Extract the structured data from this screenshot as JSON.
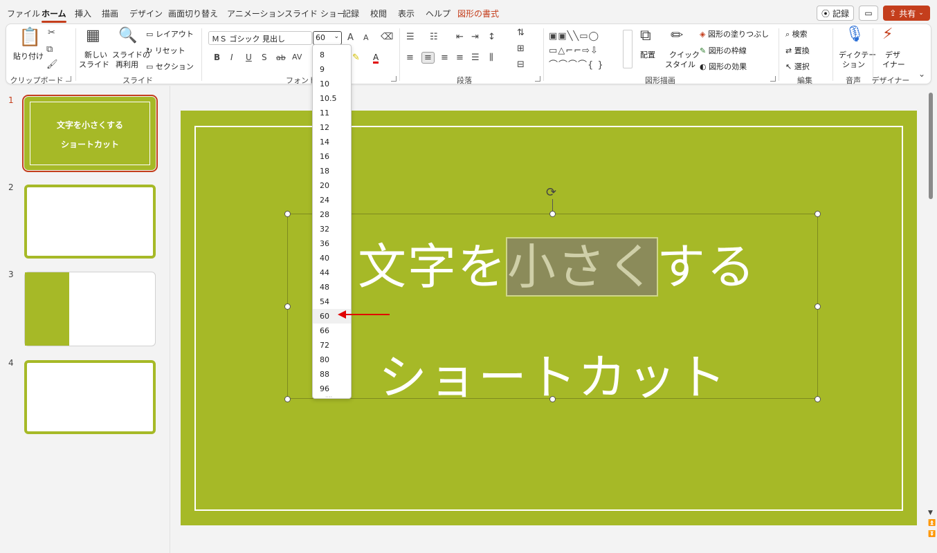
{
  "tabs": {
    "items": [
      "ファイル",
      "ホーム",
      "挿入",
      "描画",
      "デザイン",
      "画面切り替え",
      "アニメーション",
      "スライド ショー",
      "記録",
      "校閲",
      "表示",
      "ヘルプ",
      "図形の書式"
    ],
    "record_button": "記録",
    "share_button": "共有"
  },
  "ribbon": {
    "clipboard": {
      "paste": "貼り付け",
      "label": "クリップボード"
    },
    "slides": {
      "new_slide_1": "新しい",
      "new_slide_2": "スライド",
      "reuse_1": "スライドの",
      "reuse_2": "再利用",
      "layout": "レイアウト",
      "reset": "リセット",
      "section": "セクション",
      "label": "スライド"
    },
    "font": {
      "name": "ＭＳ ゴシック 見出し",
      "size": "60",
      "bold": "B",
      "italic": "I",
      "underline": "U",
      "shadow": "S",
      "strike": "ab",
      "spacing": "AV",
      "grow": "A",
      "shrink": "A",
      "color_a": "A",
      "label": "フォント"
    },
    "paragraph": {
      "label": "段落"
    },
    "drawing": {
      "arrange": "配置",
      "quick_style_1": "クイック",
      "quick_style_2": "スタイル",
      "fill": "図形の塗りつぶし",
      "outline": "図形の枠線",
      "effects": "図形の効果",
      "label": "図形描画"
    },
    "editing": {
      "find": "検索",
      "replace": "置換",
      "select": "選択",
      "label": "編集"
    },
    "voice": {
      "dictate_1": "ディクテー",
      "dictate_2": "ション",
      "label": "音声"
    },
    "designer": {
      "name_1": "デザ",
      "name_2": "イナー",
      "label": "デザイナー"
    }
  },
  "font_size_options": [
    "8",
    "9",
    "10",
    "10.5",
    "11",
    "12",
    "14",
    "16",
    "18",
    "20",
    "24",
    "28",
    "32",
    "36",
    "40",
    "44",
    "48",
    "54",
    "60",
    "66",
    "72",
    "80",
    "88",
    "96"
  ],
  "selected_size": "60",
  "slides": {
    "numbers": [
      "1",
      "2",
      "3",
      "4"
    ],
    "thumb1_line1": "文字を小さくする",
    "thumb1_line2": "ショートカット"
  },
  "canvas": {
    "title_before": "文字を",
    "title_selected": "小さく",
    "title_after": "する",
    "subtitle": "ショートカット"
  },
  "colors": {
    "accent": "#c43e1c",
    "slide_bg": "#a6b927",
    "arrow": "#e00000"
  }
}
